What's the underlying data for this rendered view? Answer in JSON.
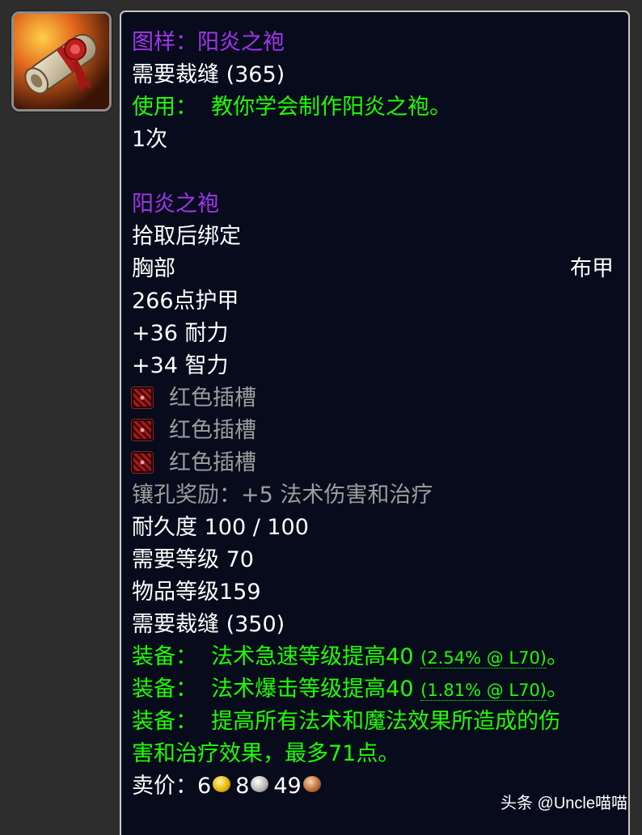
{
  "icon": {
    "name": "recipe-scroll-icon"
  },
  "tooltip": {
    "recipe_title": "图样：阳炎之袍",
    "requires_skill_top": "需要裁缝 (365)",
    "use_prefix": "使用：",
    "use_text": "教你学会制作阳炎之袍。",
    "charges": "1次",
    "item_name": "阳炎之袍",
    "binding": "拾取后绑定",
    "slot": "胸部",
    "armor_type": "布甲",
    "armor": "266点护甲",
    "stat_stamina": "+36 耐力",
    "stat_intellect": "+34 智力",
    "sockets": [
      {
        "label": "红色插槽",
        "color": "#b22222"
      },
      {
        "label": "红色插槽",
        "color": "#b22222"
      },
      {
        "label": "红色插槽",
        "color": "#b22222"
      }
    ],
    "socket_bonus": "镶孔奖励：+5 法术伤害和治疗",
    "durability": "耐久度 100 / 100",
    "required_level": "需要等级 70",
    "item_level": "物品等级159",
    "requires_skill_bottom": "需要裁缝 (350)",
    "equip_prefix": "装备：",
    "equip_1_text": "法术急速等级提高40",
    "equip_1_note": "(2.54% @ L70)",
    "equip_1_end": "。",
    "equip_2_text": "法术爆击等级提高40",
    "equip_2_note": "(1.81% @ L70)",
    "equip_2_end": "。",
    "equip_3_line1": "提高所有法术和魔法效果所造成的伤",
    "equip_3_line2": "害和治疗效果，最多71点。",
    "sell_label": "卖价：",
    "sell_gold": "6",
    "sell_silver": "8",
    "sell_copper": "49"
  },
  "colors": {
    "epic": "#a335ee",
    "uncommon": "#1eff00",
    "poor": "#9d9d9d",
    "common": "#ffffff",
    "background": "#070b1c"
  },
  "watermark": "头条 @Uncle喵喵"
}
